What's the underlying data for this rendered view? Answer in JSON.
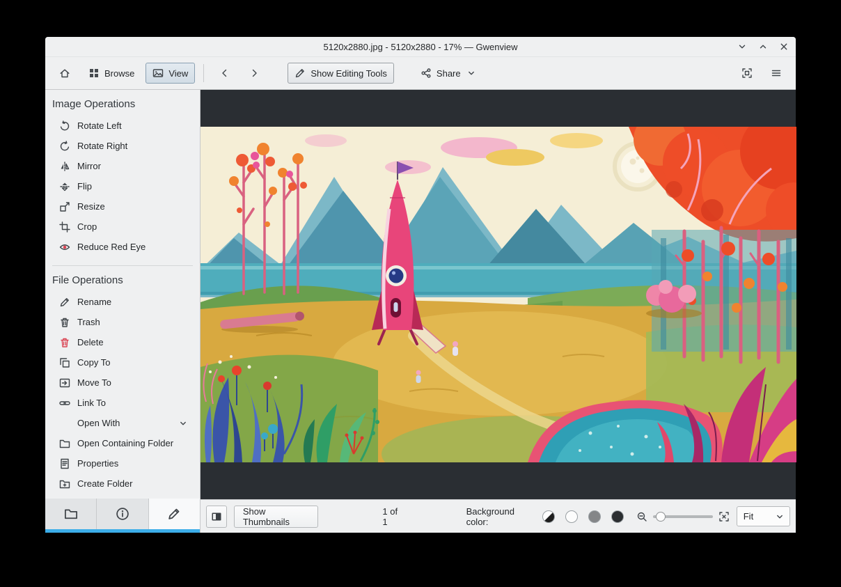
{
  "window": {
    "title": "5120x2880.jpg - 5120x2880 - 17% — Gwenview",
    "controls": [
      {
        "name": "minimize",
        "icon": "chevron-down-icon"
      },
      {
        "name": "maximize",
        "icon": "chevron-up-icon"
      },
      {
        "name": "close",
        "icon": "close-icon"
      }
    ]
  },
  "toolbar": {
    "home": {
      "icon": "home-icon"
    },
    "browse": {
      "label": "Browse",
      "icon": "grid-icon"
    },
    "view": {
      "label": "View",
      "icon": "image-icon",
      "active": true
    },
    "back": {
      "icon": "arrow-left-icon"
    },
    "forward": {
      "icon": "arrow-right-icon"
    },
    "editing_tools": {
      "label": "Show Editing Tools",
      "icon": "pencil-icon",
      "active": true
    },
    "share": {
      "label": "Share",
      "icon": "share-icon",
      "chevron": "chevron-down-icon"
    },
    "fit_page": {
      "icon": "zoom-fit-icon"
    },
    "menu": {
      "icon": "hamburger-icon"
    }
  },
  "sidebar": {
    "image_operations": {
      "title": "Image Operations",
      "items": [
        {
          "label": "Rotate Left",
          "icon": "rotate-left-icon"
        },
        {
          "label": "Rotate Right",
          "icon": "rotate-right-icon"
        },
        {
          "label": "Mirror",
          "icon": "mirror-icon"
        },
        {
          "label": "Flip",
          "icon": "flip-icon"
        },
        {
          "label": "Resize",
          "icon": "resize-icon"
        },
        {
          "label": "Crop",
          "icon": "crop-icon"
        },
        {
          "label": "Reduce Red Eye",
          "icon": "red-eye-icon"
        }
      ]
    },
    "file_operations": {
      "title": "File Operations",
      "items": [
        {
          "label": "Rename",
          "icon": "rename-icon"
        },
        {
          "label": "Trash",
          "icon": "trash-icon"
        },
        {
          "label": "Delete",
          "icon": "delete-icon"
        },
        {
          "label": "Copy To",
          "icon": "copy-icon"
        },
        {
          "label": "Move To",
          "icon": "move-icon"
        },
        {
          "label": "Link To",
          "icon": "link-icon"
        }
      ],
      "open_with": {
        "label": "Open With",
        "icon": "chevron-down-icon"
      },
      "more_items": [
        {
          "label": "Open Containing Folder",
          "icon": "folder-open-icon"
        },
        {
          "label": "Properties",
          "icon": "properties-icon"
        },
        {
          "label": "Create Folder",
          "icon": "folder-new-icon"
        }
      ]
    },
    "tabs": [
      {
        "name": "folders",
        "icon": "folder-icon"
      },
      {
        "name": "information",
        "icon": "info-icon"
      },
      {
        "name": "operations",
        "icon": "pencil-icon",
        "active": true
      }
    ]
  },
  "statusbar": {
    "toggle_sidebar": {
      "icon": "sidebar-toggle-icon"
    },
    "show_thumbnails_label": "Show Thumbnails",
    "page_indicator": "1 of 1",
    "background_color_label": "Background color:",
    "swatches": [
      "auto",
      "white",
      "gray",
      "black"
    ],
    "zoom_out": {
      "icon": "zoom-out-icon"
    },
    "zoom_fit": {
      "icon": "zoom-fit-icon"
    },
    "zoom_mode": "Fit"
  },
  "image": {
    "description": "Colorful illustrated landscape: pink rocket on a yellow field, teal mountains, red and orange trees, pond and magenta plants"
  },
  "colors": {
    "accent": "#3daee9",
    "danger": "#da4453",
    "viewer_background": "#2a2e33",
    "chrome_background": "#eff0f1"
  }
}
